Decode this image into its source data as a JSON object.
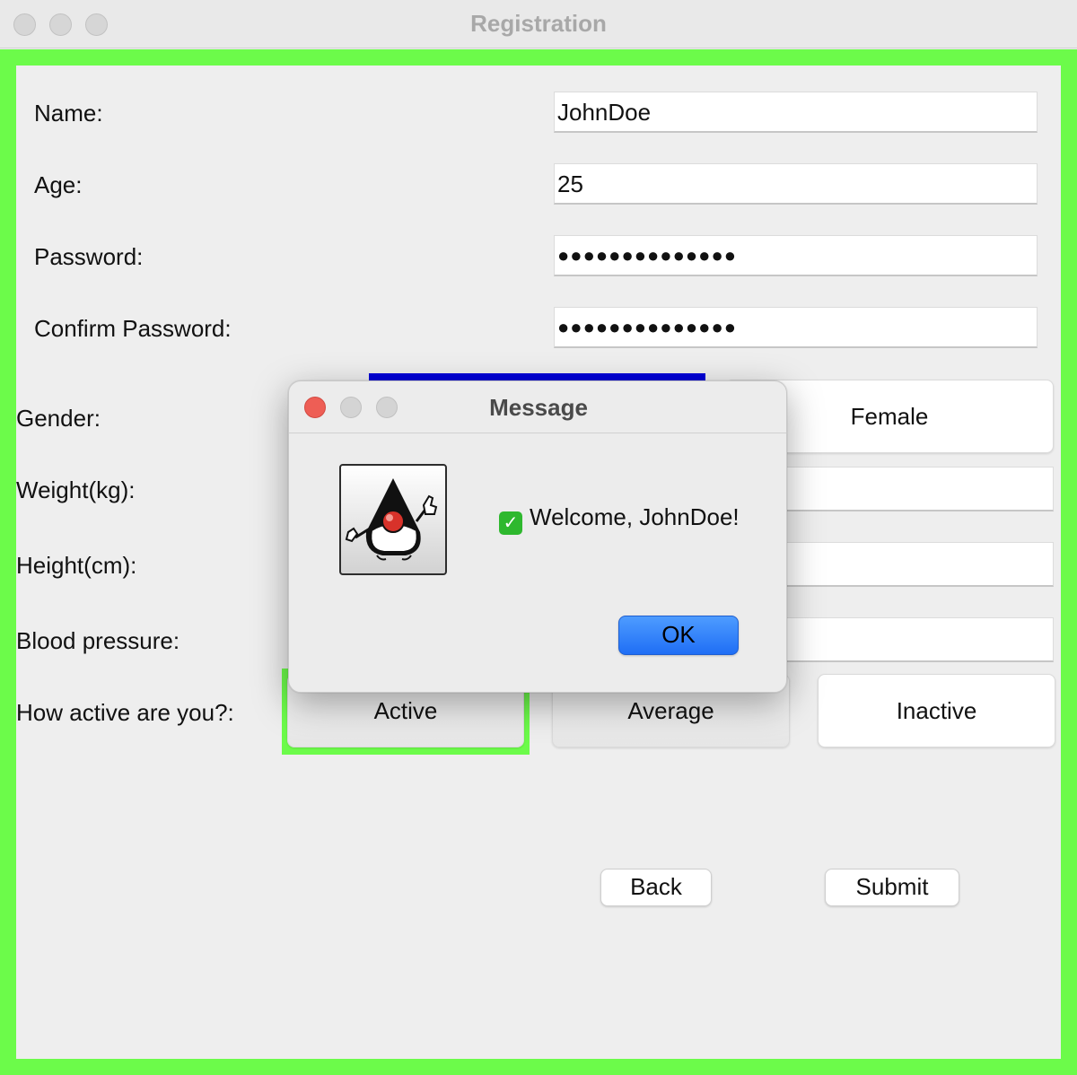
{
  "window": {
    "title": "Registration"
  },
  "form": {
    "name_label": "Name:",
    "name_value": "JohnDoe",
    "age_label": "Age:",
    "age_value": "25",
    "password_label": "Password:",
    "password_value": "●●●●●●●●●●●●●●",
    "confirm_label": "Confirm Password:",
    "confirm_value": "●●●●●●●●●●●●●●",
    "gender_label": "Gender:",
    "gender_female": "Female",
    "weight_label": "Weight(kg):",
    "height_label": "Height(cm):",
    "bp_label": "Blood pressure:",
    "activity_label": "How active are you?:",
    "activity_options": [
      "Active",
      "Average",
      "Inactive"
    ],
    "back_label": "Back",
    "submit_label": "Submit"
  },
  "dialog": {
    "title": "Message",
    "message": "Welcome, JohnDoe!",
    "ok_label": "OK",
    "icon": "java-duke-icon"
  },
  "colors": {
    "frame_green": "#6cfb4a",
    "selection_blue": "#0000d8",
    "ok_blue": "#1f6ef5"
  }
}
